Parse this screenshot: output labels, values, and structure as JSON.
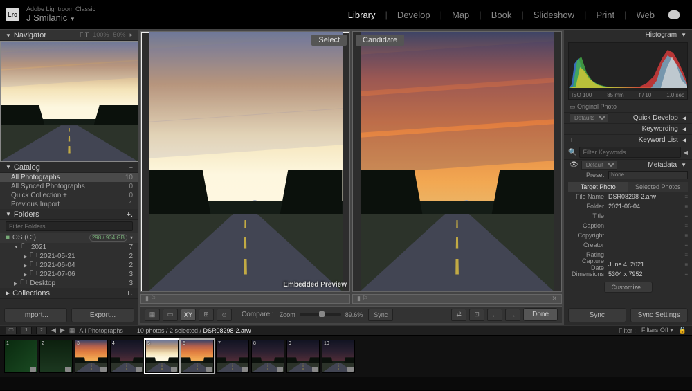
{
  "app": {
    "title": "Adobe Lightroom Classic",
    "user": "J Smilanic"
  },
  "modules": [
    "Library",
    "Develop",
    "Map",
    "Book",
    "Slideshow",
    "Print",
    "Web"
  ],
  "active_module": "Library",
  "navigator": {
    "title": "Navigator",
    "fit": "FIT",
    "zoom1": "100%",
    "zoom2": "50%"
  },
  "catalog": {
    "title": "Catalog",
    "items": [
      {
        "label": "All Photographs",
        "count": 10,
        "selected": true
      },
      {
        "label": "All Synced Photographs",
        "count": 0
      },
      {
        "label": "Quick Collection +",
        "count": 0
      },
      {
        "label": "Previous Import",
        "count": 1
      }
    ]
  },
  "folders": {
    "title": "Folders",
    "filter_placeholder": "Filter Folders",
    "drive": {
      "name": "OS (C:)",
      "usage": "298 / 934 GB"
    },
    "tree": [
      {
        "label": "2021",
        "count": 7,
        "depth": 1,
        "expanded": true
      },
      {
        "label": "2021-05-21",
        "count": 2,
        "depth": 2
      },
      {
        "label": "2021-06-04",
        "count": 2,
        "depth": 2
      },
      {
        "label": "2021-07-06",
        "count": 3,
        "depth": 2
      },
      {
        "label": "Desktop",
        "count": 3,
        "depth": 1
      }
    ]
  },
  "collections": {
    "title": "Collections"
  },
  "buttons": {
    "import": "Import...",
    "export": "Export..."
  },
  "compare": {
    "select_label": "Select",
    "candidate_label": "Candidate",
    "embedded_label": "Embedded Preview",
    "compare_label": "Compare :",
    "zoom_label": "Zoom",
    "zoom_value": "89.6%",
    "sync_btn": "Sync",
    "done_btn": "Done"
  },
  "right": {
    "histogram": "Histogram",
    "histo_labels": {
      "iso": "ISO 100",
      "focal": "85 mm",
      "aperture": "f / 10",
      "shutter": "1.0 sec"
    },
    "original_photo": "Original Photo",
    "defaults": "Defaults",
    "quick_develop": "Quick Develop",
    "keywording": "Keywording",
    "keyword_list": "Keyword List",
    "filter_keywords_placeholder": "Filter Keywords",
    "metadata": "Metadata",
    "meta_default": "Default",
    "tabs": {
      "target": "Target Photo",
      "selected": "Selected Photos"
    },
    "preset_label": "Preset",
    "preset_value": "None",
    "fields": [
      {
        "label": "File Name",
        "value": "DSR08298-2.arw"
      },
      {
        "label": "Folder",
        "value": "2021-06-04"
      },
      {
        "label": "Title",
        "value": ""
      },
      {
        "label": "Caption",
        "value": ""
      },
      {
        "label": "Copyright",
        "value": ""
      },
      {
        "label": "Creator",
        "value": ""
      },
      {
        "label": "Rating",
        "value": "· · · · ·"
      },
      {
        "label": "Capture Date",
        "value": "June 4, 2021"
      },
      {
        "label": "Dimensions",
        "value": "5304 x 7952"
      }
    ],
    "customize": "Customize...",
    "sync": "Sync",
    "sync_settings": "Sync Settings"
  },
  "secbar": {
    "all_photographs": "All Photographs",
    "status": "10 photos / 2 selected /",
    "filename": "DSR08298-2.arw",
    "filter_label": "Filter :",
    "filter_value": "Filters Off"
  },
  "filmstrip": {
    "count": 10,
    "select_idx": 5,
    "candidate_idx": 6
  }
}
